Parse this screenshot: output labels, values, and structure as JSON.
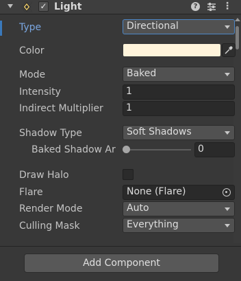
{
  "header": {
    "title": "Light",
    "enabled_check": "✓",
    "help_glyph": "?",
    "more_glyph": "⋮"
  },
  "properties": {
    "type": {
      "label": "Type",
      "value": "Directional"
    },
    "color": {
      "label": "Color",
      "value": "#fff4db"
    },
    "mode": {
      "label": "Mode",
      "value": "Baked"
    },
    "intensity": {
      "label": "Intensity",
      "value": "1"
    },
    "indirect_multiplier": {
      "label": "Indirect Multiplier",
      "value": "1"
    },
    "shadow_type": {
      "label": "Shadow Type",
      "value": "Soft Shadows"
    },
    "baked_shadow_angle": {
      "label": "Baked Shadow Ar",
      "value": "0",
      "fraction": 0
    },
    "draw_halo": {
      "label": "Draw Halo",
      "checked": false
    },
    "flare": {
      "label": "Flare",
      "value": "None (Flare)"
    },
    "render_mode": {
      "label": "Render Mode",
      "value": "Auto"
    },
    "culling_mask": {
      "label": "Culling Mask",
      "value": "Everything"
    }
  },
  "footer": {
    "add_component_label": "Add Component"
  },
  "colors": {
    "accent": "#4d87c7",
    "light_color": "#fff4db",
    "background": "#383838"
  }
}
